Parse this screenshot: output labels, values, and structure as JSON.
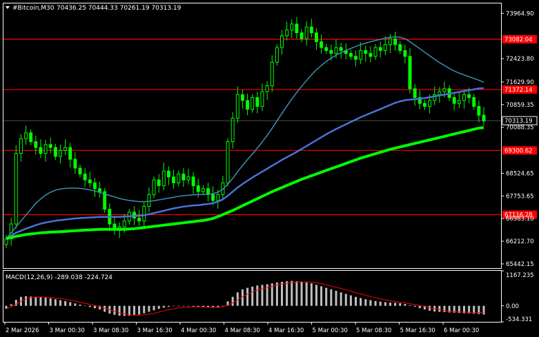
{
  "header": {
    "symbol_text": "#Bitcoin,M30",
    "ohlc_text": "70436.25 70444.33 70261.19 70313.19"
  },
  "price_axis": {
    "labels": [
      "73964.90",
      "72423.80",
      "71629.90",
      "70859.35",
      "70088.35",
      "68524.65",
      "67753.65",
      "66983.10",
      "66212.70",
      "65442.15"
    ],
    "current_price": "70313.19"
  },
  "levels": [
    {
      "label": "73082.04",
      "value": 73082.04
    },
    {
      "label": "71372.14",
      "value": 71372.14
    },
    {
      "label": "69300.62",
      "value": 69300.62
    },
    {
      "label": "67116.28",
      "value": 67116.28
    }
  ],
  "time_axis": {
    "labels": [
      "2 Mar 2026",
      "3 Mar 00:30",
      "3 Mar 08:30",
      "3 Mar 16:30",
      "4 Mar 00:30",
      "4 Mar 08:30",
      "4 Mar 16:30",
      "5 Mar 00:30",
      "5 Mar 08:30",
      "5 Mar 16:30",
      "6 Mar 00:30"
    ]
  },
  "macd": {
    "title": "MACD(12,26,9) -289.038 -224.724",
    "axis_labels": [
      "1167.235",
      "0.00",
      "-534.331"
    ]
  },
  "colors": {
    "background": "#000000",
    "candle": "#00ff00",
    "level": "#ff0000",
    "ma_fast": "#3c8fb0",
    "ma_mid": "#4a72d8",
    "ma_slow": "#00ff00",
    "macd_hist": "#c0c0c0",
    "macd_signal": "#ff0000"
  },
  "chart_data": {
    "type": "candlestick",
    "symbol": "#Bitcoin",
    "timeframe": "M30",
    "ylim": [
      65300,
      74300
    ],
    "close_series": [
      66300,
      66800,
      69200,
      69700,
      69900,
      69600,
      69400,
      69200,
      69500,
      69400,
      69100,
      69300,
      69400,
      69000,
      68700,
      68500,
      68300,
      68200,
      68000,
      67900,
      67300,
      66800,
      66600,
      66700,
      66900,
      67200,
      67000,
      66900,
      67400,
      67800,
      68300,
      68100,
      68600,
      68400,
      68200,
      68500,
      68300,
      68400,
      68100,
      67900,
      68000,
      67800,
      67600,
      67800,
      68200,
      69600,
      70400,
      71200,
      71000,
      70700,
      71100,
      70800,
      71300,
      71500,
      72300,
      72800,
      73200,
      73400,
      73600,
      73300,
      73100,
      73500,
      73300,
      73000,
      72800,
      72700,
      72600,
      72800,
      72700,
      72600,
      72500,
      72400,
      72700,
      72600,
      72500,
      72800,
      72700,
      72900,
      73100,
      72900,
      72700,
      72500,
      71400,
      71100,
      70900,
      70800,
      71000,
      71200,
      71300,
      71400,
      71100,
      70900,
      71000,
      71200,
      71100,
      70800,
      70500,
      70300
    ],
    "ma_fast": [
      66300,
      66500,
      66700,
      66900,
      67100,
      67300,
      67500,
      67650,
      67780,
      67880,
      67950,
      67990,
      68010,
      68020,
      68020,
      68010,
      67990,
      67960,
      67920,
      67870,
      67820,
      67770,
      67720,
      67670,
      67630,
      67600,
      67580,
      67560,
      67560,
      67570,
      67590,
      67620,
      67650,
      67680,
      67710,
      67740,
      67760,
      67780,
      67790,
      67800,
      67800,
      67810,
      67830,
      67880,
      67980,
      68150,
      68350,
      68580,
      68790,
      68990,
      69180,
      69380,
      69590,
      69810,
      70050,
      70310,
      70560,
      70810,
      71050,
      71270,
      71480,
      71680,
      71870,
      72040,
      72190,
      72330,
      72440,
      72540,
      72630,
      72700,
      72770,
      72840,
      72900,
      72950,
      73000,
      73040,
      73080,
      73120,
      73150,
      73170,
      73150,
      73100,
      73000,
      72880,
      72760,
      72640,
      72520,
      72400,
      72290,
      72190,
      72090,
      72000,
      71930,
      71870,
      71810,
      71750,
      71690,
      71620
    ],
    "ma_mid": [
      66300,
      66400,
      66500,
      66570,
      66640,
      66700,
      66760,
      66810,
      66850,
      66880,
      66910,
      66930,
      66950,
      66970,
      66990,
      67000,
      67010,
      67020,
      67030,
      67040,
      67040,
      67040,
      67040,
      67040,
      67050,
      67060,
      67070,
      67080,
      67100,
      67130,
      67170,
      67210,
      67250,
      67290,
      67330,
      67360,
      67390,
      67410,
      67430,
      67440,
      67460,
      67480,
      67510,
      67560,
      67640,
      67760,
      67900,
      68040,
      68160,
      68270,
      68380,
      68480,
      68580,
      68680,
      68780,
      68880,
      68980,
      69070,
      69160,
      69250,
      69350,
      69450,
      69550,
      69650,
      69750,
      69850,
      69940,
      70030,
      70110,
      70190,
      70270,
      70350,
      70430,
      70500,
      70570,
      70640,
      70710,
      70780,
      70850,
      70920,
      70970,
      71010,
      71030,
      71040,
      71060,
      71080,
      71110,
      71140,
      71170,
      71200,
      71230,
      71260,
      71290,
      71320,
      71350,
      71380,
      71410,
      71420
    ],
    "ma_slow": [
      66300,
      66340,
      66380,
      66410,
      66440,
      66460,
      66480,
      66500,
      66510,
      66520,
      66530,
      66540,
      66550,
      66560,
      66570,
      66580,
      66590,
      66600,
      66610,
      66620,
      66620,
      66620,
      66620,
      66620,
      66620,
      66630,
      66640,
      66660,
      66680,
      66700,
      66720,
      66740,
      66760,
      66780,
      66800,
      66820,
      66840,
      66860,
      66880,
      66900,
      66920,
      66950,
      66990,
      67050,
      67120,
      67190,
      67260,
      67340,
      67420,
      67500,
      67580,
      67660,
      67740,
      67820,
      67900,
      67970,
      68040,
      68110,
      68180,
      68250,
      68320,
      68380,
      68440,
      68500,
      68560,
      68620,
      68680,
      68740,
      68800,
      68860,
      68920,
      68980,
      69040,
      69090,
      69140,
      69190,
      69240,
      69290,
      69340,
      69380,
      69420,
      69460,
      69500,
      69540,
      69580,
      69620,
      69660,
      69700,
      69740,
      69780,
      69820,
      69860,
      69900,
      69940,
      69980,
      70020,
      70060,
      70080
    ],
    "macd_hist": [
      -100,
      50,
      200,
      300,
      320,
      310,
      300,
      290,
      270,
      250,
      220,
      190,
      160,
      120,
      80,
      40,
      0,
      -40,
      -80,
      -120,
      -200,
      -260,
      -300,
      -330,
      -340,
      -330,
      -310,
      -290,
      -250,
      -200,
      -150,
      -100,
      -60,
      -30,
      -10,
      0,
      0,
      -10,
      -20,
      -30,
      -40,
      -50,
      -60,
      -40,
      0,
      150,
      300,
      450,
      550,
      600,
      640,
      680,
      700,
      720,
      750,
      780,
      800,
      820,
      830,
      820,
      800,
      780,
      750,
      700,
      650,
      600,
      550,
      500,
      450,
      400,
      350,
      300,
      260,
      220,
      190,
      160,
      140,
      120,
      110,
      100,
      90,
      60,
      20,
      -30,
      -80,
      -120,
      -160,
      -190,
      -200,
      -210,
      -220,
      -230,
      -240,
      -250,
      -250,
      -260,
      -270,
      -289
    ],
    "macd_signal": [
      -100,
      -40,
      50,
      150,
      230,
      270,
      290,
      295,
      290,
      280,
      265,
      245,
      220,
      190,
      155,
      120,
      85,
      50,
      10,
      -30,
      -80,
      -130,
      -180,
      -230,
      -270,
      -300,
      -310,
      -310,
      -300,
      -280,
      -250,
      -210,
      -170,
      -130,
      -100,
      -70,
      -50,
      -40,
      -35,
      -35,
      -40,
      -45,
      -50,
      -50,
      -30,
      20,
      100,
      200,
      300,
      390,
      460,
      520,
      570,
      610,
      650,
      690,
      720,
      750,
      770,
      790,
      800,
      800,
      790,
      770,
      740,
      700,
      660,
      620,
      580,
      530,
      490,
      440,
      400,
      350,
      310,
      270,
      230,
      200,
      170,
      140,
      120,
      100,
      70,
      40,
      10,
      -20,
      -60,
      -100,
      -130,
      -160,
      -180,
      -195,
      -205,
      -212,
      -218,
      -221,
      -223,
      -224
    ],
    "macd_ylim": [
      -534.331,
      1167.235
    ]
  }
}
